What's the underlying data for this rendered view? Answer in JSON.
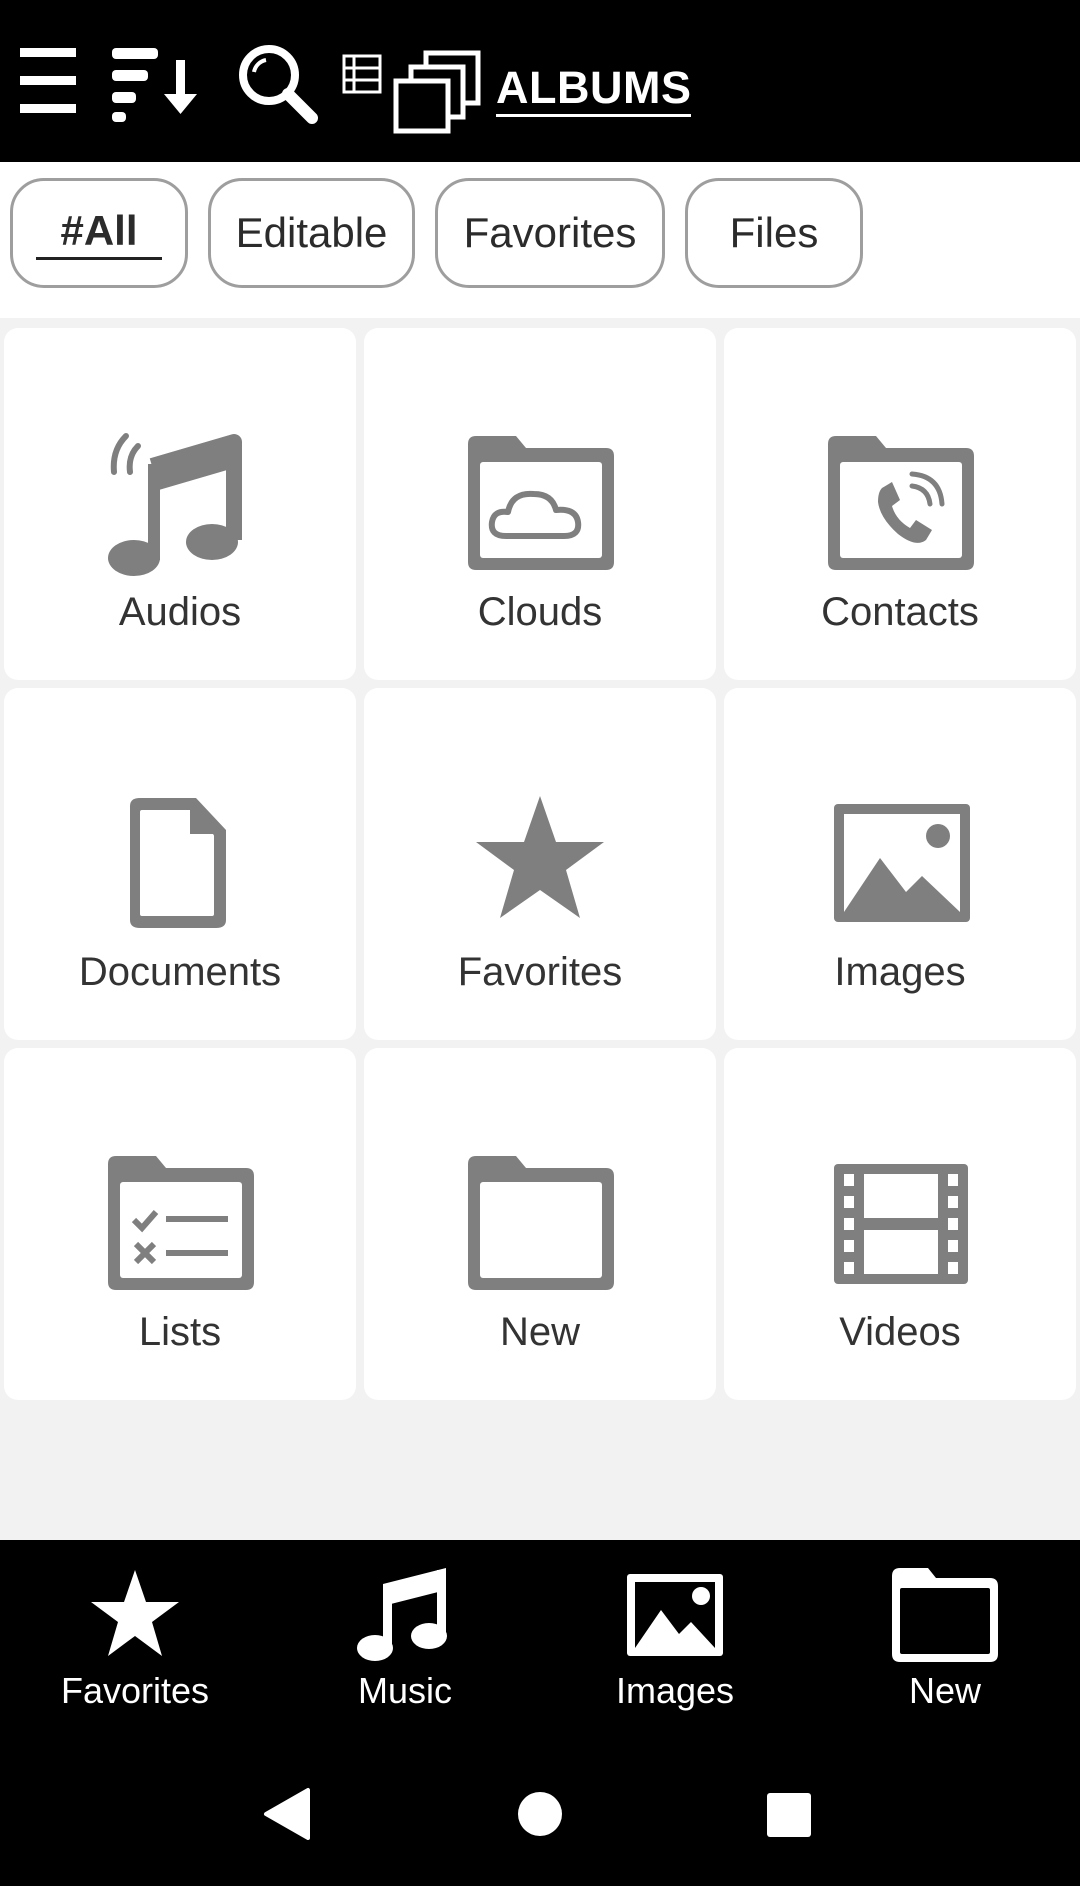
{
  "toolbar": {
    "title": "ALBUMS",
    "icons": [
      "menu-icon",
      "sort-icon",
      "search-icon",
      "list-view-icon",
      "albums-icon"
    ]
  },
  "filters": [
    {
      "label": "#All",
      "active": true
    },
    {
      "label": "Editable",
      "active": false
    },
    {
      "label": "Favorites",
      "active": false
    },
    {
      "label": "Files",
      "active": false
    }
  ],
  "grid": [
    {
      "label": "Audios",
      "icon": "music-note-icon"
    },
    {
      "label": "Clouds",
      "icon": "cloud-folder-icon"
    },
    {
      "label": "Contacts",
      "icon": "contacts-folder-icon"
    },
    {
      "label": "Documents",
      "icon": "document-icon"
    },
    {
      "label": "Favorites",
      "icon": "star-icon"
    },
    {
      "label": "Images",
      "icon": "image-icon"
    },
    {
      "label": "Lists",
      "icon": "checklist-folder-icon"
    },
    {
      "label": "New",
      "icon": "folder-icon"
    },
    {
      "label": "Videos",
      "icon": "film-icon"
    }
  ],
  "bottom_nav": [
    {
      "label": "Favorites",
      "icon": "star-icon"
    },
    {
      "label": "Music",
      "icon": "music-note-icon"
    },
    {
      "label": "Images",
      "icon": "image-icon"
    },
    {
      "label": "New",
      "icon": "folder-icon"
    }
  ],
  "system_nav": [
    "back-icon",
    "home-icon",
    "recents-icon"
  ],
  "colors": {
    "toolbar": "#000000",
    "icon_gray": "#7f7f7f",
    "background": "#f2f2f2",
    "tile": "#ffffff"
  }
}
